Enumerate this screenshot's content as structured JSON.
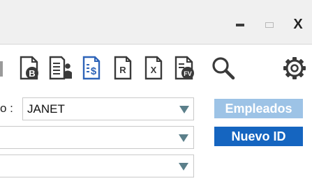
{
  "window": {
    "minimize_symbol": "–",
    "maximize_symbol": "",
    "close_symbol": "X"
  },
  "toolbar": {
    "icons": [
      "document-b-icon",
      "employee-document-icon",
      "document-dollar-icon",
      "document-r-icon",
      "document-x-icon",
      "document-fv-icon",
      "search-icon",
      "gear-icon"
    ]
  },
  "form": {
    "field1_label": "o :",
    "field1_value": "JANET",
    "field2_value": "",
    "field3_value": ""
  },
  "buttons": {
    "empleados": "Empleados",
    "nuevo_id": "Nuevo ID"
  },
  "colors": {
    "empleados_button": "#9dc3e6",
    "nuevo_id_button": "#1565c0",
    "dropdown_arrow": "#5b7f8a",
    "titlebar": "#f0f0f0"
  }
}
